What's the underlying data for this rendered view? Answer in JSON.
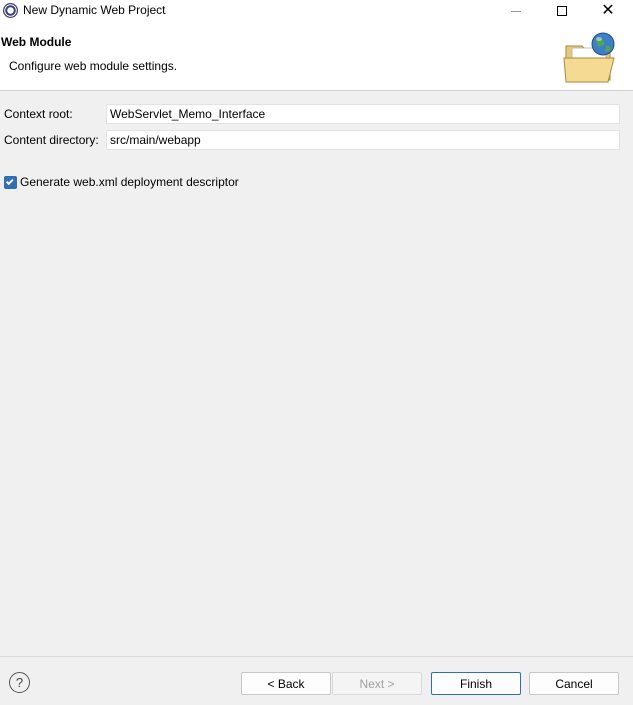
{
  "window": {
    "title": "New Dynamic Web Project",
    "icons": [
      "eclipse-app-icon",
      "minimize-icon",
      "maximize-icon",
      "close-icon"
    ]
  },
  "header": {
    "title": "Web Module",
    "description": "Configure web module settings.",
    "banner_icon": "folder-globe-icon"
  },
  "form": {
    "context_root_label": "Context root:",
    "context_root_value": "WebServlet_Memo_Interface",
    "content_dir_label": "Content directory:",
    "content_dir_value": "src/main/webapp",
    "generate_webxml_label": "Generate web.xml deployment descriptor",
    "generate_webxml_checked": true
  },
  "footer": {
    "help_icon": "help-icon",
    "help_glyph": "?",
    "back_label": "< Back",
    "next_label": "Next >",
    "finish_label": "Finish",
    "cancel_label": "Cancel"
  },
  "colors": {
    "accent": "#2f6fb4",
    "background": "#f0f0f0",
    "header_bg": "#ffffff"
  }
}
